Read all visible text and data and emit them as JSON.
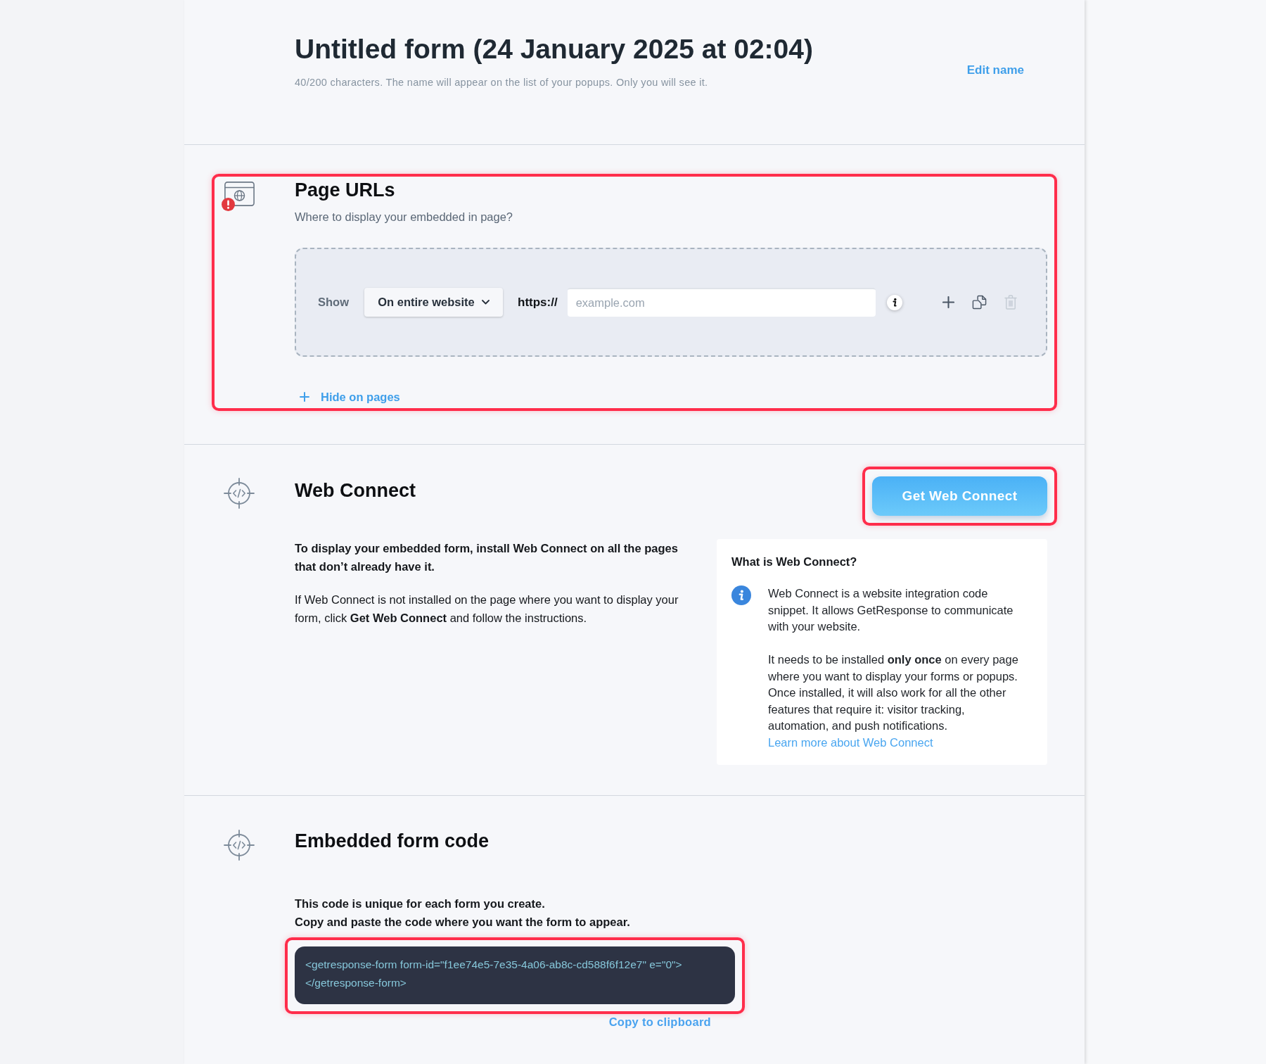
{
  "header": {
    "title": "Untitled form (24 January 2025 at 02:04)",
    "hint": "40/200 characters. The name will appear on the list of your popups. Only you will see it.",
    "edit_link": "Edit name"
  },
  "page_urls": {
    "title": "Page URLs",
    "description": "Where to display your embedded in page?",
    "error": true,
    "highlighted": true,
    "rules": [
      {
        "label": "Show",
        "mode": "On entire website",
        "protocol": "https://",
        "url": {
          "placeholder": "example.com"
        },
        "actions": [
          {
            "kind": "add",
            "disabled": false
          },
          {
            "kind": "duplicate",
            "disabled": false
          },
          {
            "kind": "delete",
            "disabled": true
          }
        ]
      }
    ],
    "hide_link": "Hide on pages"
  },
  "web_connect": {
    "title": "Web Connect",
    "button": {
      "label": "Get Web Connect",
      "highlighted": true
    },
    "paragraphs": [
      {
        "kind": "lead",
        "text": "To display your embedded form, install Web Connect on all the pages that don’t already have it."
      },
      {
        "kind": "body",
        "text": "If Web Connect is not installed on the page where you want to display your form, click **Get Web Connect** and follow the instructions."
      }
    ],
    "info_card": {
      "title": "What is Web Connect?",
      "paragraphs": [
        "Web Connect is a website integration code snippet. It allows GetResponse to communicate with your website.",
        "It needs to be installed **only once** on every page where you want to display your forms or popups. Once installed, it will also work for all the other features that require it: visitor tracking, automation, and push notifications."
      ],
      "link": "Learn more about Web Connect"
    }
  },
  "embed_code": {
    "title": "Embedded form code",
    "instructions": [
      "This code is unique for each form you create.",
      "Copy and paste the code where you want the form to appear."
    ],
    "code": "<getresponse-form form-id=\"f1ee74e5-7e35-4a06-ab8c-cd588f6f12e7\" e=\"0\">\n</getresponse-form>",
    "highlighted": true,
    "copy_link": "Copy to clipboard"
  }
}
